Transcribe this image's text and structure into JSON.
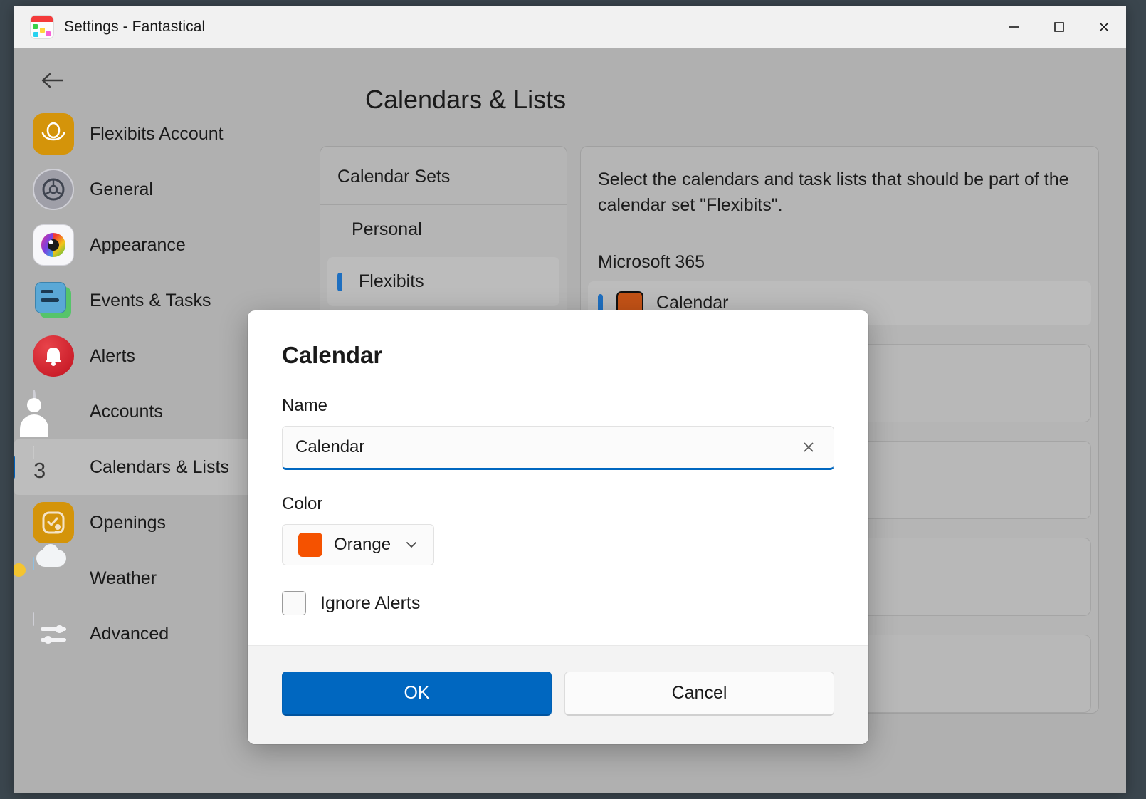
{
  "window": {
    "title": "Settings - Fantastical",
    "app_icon": "fantastical-icon",
    "controls": {
      "minimize": "minimize-icon",
      "maximize": "maximize-icon",
      "close": "close-icon"
    }
  },
  "sidebar": {
    "back": "back-arrow-icon",
    "items": [
      {
        "label": "Flexibits Account",
        "icon": "flexibits-account-icon",
        "selected": false
      },
      {
        "label": "General",
        "icon": "gear-icon",
        "selected": false
      },
      {
        "label": "Appearance",
        "icon": "color-wheel-icon",
        "selected": false
      },
      {
        "label": "Events & Tasks",
        "icon": "events-tasks-icon",
        "selected": false
      },
      {
        "label": "Alerts",
        "icon": "bell-icon",
        "selected": false
      },
      {
        "label": "Accounts",
        "icon": "person-icon",
        "selected": false
      },
      {
        "label": "Calendars & Lists",
        "icon": "calendar-icon",
        "selected": true,
        "badge": "3"
      },
      {
        "label": "Openings",
        "icon": "openings-icon",
        "selected": false
      },
      {
        "label": "Weather",
        "icon": "weather-icon",
        "selected": false
      },
      {
        "label": "Advanced",
        "icon": "sliders-icon",
        "selected": false
      }
    ]
  },
  "main": {
    "page_title": "Calendars & Lists",
    "calendar_sets": {
      "header": "Calendar Sets",
      "rows": [
        {
          "label": "Personal",
          "selected": false
        },
        {
          "label": "Flexibits",
          "selected": true
        }
      ]
    },
    "calendars_panel": {
      "description": "Select the calendars and task lists that should be part of the calendar set \"Flexibits\".",
      "group_label": "Microsoft 365",
      "rows": [
        {
          "label": "Calendar",
          "color": "#c35216",
          "selected": true
        }
      ]
    }
  },
  "dialog": {
    "title": "Calendar",
    "name_label": "Name",
    "name_value": "Calendar",
    "name_placeholder": "Name",
    "clear_icon": "close-icon",
    "color_label": "Color",
    "color_value": "Orange",
    "color_hex": "#f55200",
    "color_chevron": "chevron-down-icon",
    "ignore_alerts_label": "Ignore Alerts",
    "ignore_alerts_checked": false,
    "ok_label": "OK",
    "cancel_label": "Cancel"
  },
  "colors": {
    "accent": "#0067c0",
    "selection_indicator": "#005fb8",
    "orange_swatch": "#f55200",
    "window_bg": "#b0b0b0",
    "titlebar_bg": "#f1f1f1"
  }
}
